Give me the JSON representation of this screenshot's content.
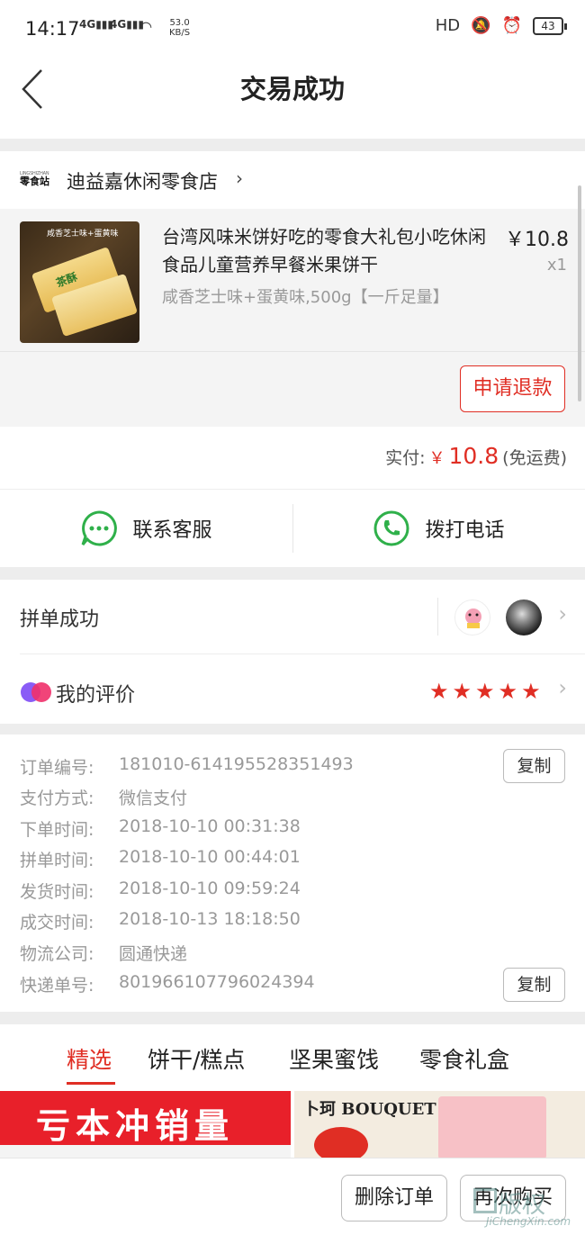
{
  "status_bar": {
    "time": "14:17",
    "signal1": "4G",
    "signal2": "4G",
    "speed_value": "53.0",
    "speed_unit": "KB/S",
    "hd_label": "HD",
    "battery": "43"
  },
  "header": {
    "title": "交易成功"
  },
  "shop": {
    "logo_small": "LINGSHIZHAN",
    "logo_text": "零食站",
    "name": "迪益嘉休闲零食店"
  },
  "product": {
    "image_banner": "咸香芝士味+蛋黄味",
    "image_label": "茶酥",
    "title": "台湾风味米饼好吃的零食大礼包小吃休闲食品儿童营养早餐米果饼干",
    "price": "￥10.8",
    "quantity": "x1",
    "spec": "咸香芝士味+蛋黄味,500g【一斤足量】",
    "refund_label": "申请退款"
  },
  "payment": {
    "label": "实付:",
    "symbol": "￥",
    "amount": "10.8",
    "note": "(免运费)"
  },
  "contact": {
    "service_label": "联系客服",
    "phone_label": "拨打电话"
  },
  "group": {
    "status_label": "拼单成功",
    "review_label": "我的评价",
    "rating": 5
  },
  "order_info": {
    "rows": [
      {
        "key": "订单编号:",
        "value": "181010-614195528351493"
      },
      {
        "key": "支付方式:",
        "value": "微信支付"
      },
      {
        "key": "下单时间:",
        "value": "2018-10-10 00:31:38"
      },
      {
        "key": "拼单时间:",
        "value": "2018-10-10 00:44:01"
      },
      {
        "key": "发货时间:",
        "value": "2018-10-10 09:59:24"
      },
      {
        "key": "成交时间:",
        "value": "2018-10-13 18:18:50"
      },
      {
        "key": "物流公司:",
        "value": "圆通快递"
      },
      {
        "key": "快递单号:",
        "value": "801966107796024394"
      }
    ],
    "copy_label": "复制"
  },
  "tabs": [
    "精选",
    "饼干/糕点",
    "坚果蜜饯",
    "零食礼盒"
  ],
  "banners": {
    "left_text": "亏本冲销量",
    "right_brand": "卜珂 BOUQUET"
  },
  "bottom_bar": {
    "delete_label": "删除订单",
    "rebuy_label": "再次购买"
  },
  "watermark": {
    "main": "版权",
    "sub": "JiChengXin.com"
  },
  "colors": {
    "accent_red": "#e02e24",
    "green": "#2fb04a"
  }
}
